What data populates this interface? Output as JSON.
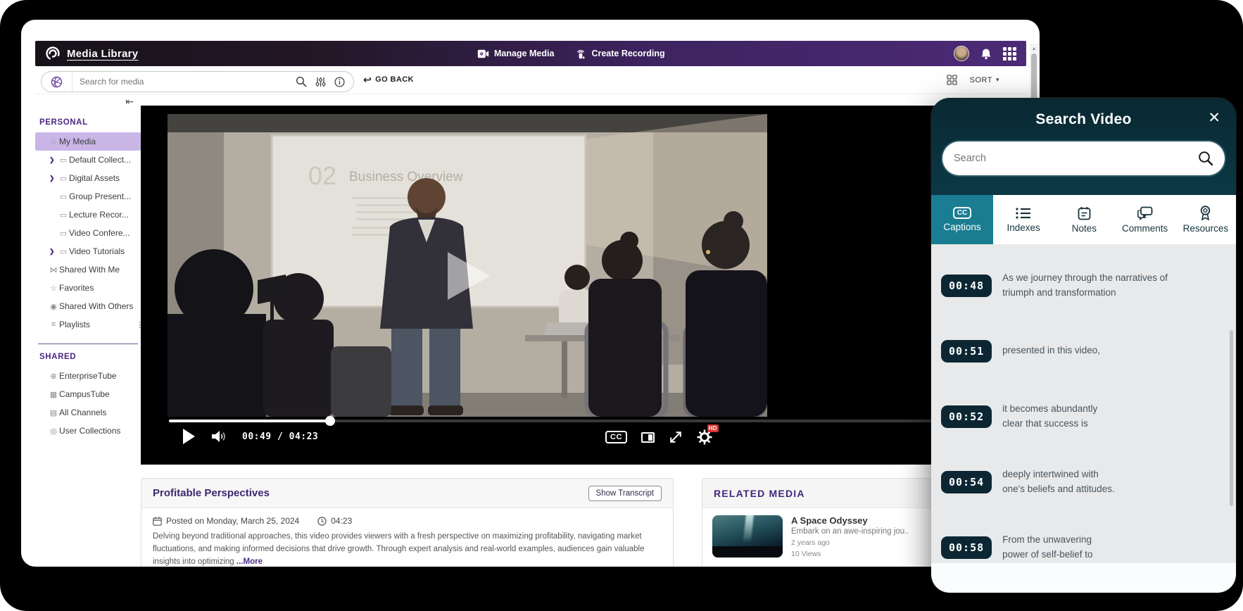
{
  "header": {
    "app_title": "Media Library",
    "manage_media_label": "Manage Media",
    "create_recording_label": "Create Recording"
  },
  "searchbar": {
    "placeholder": "Search for media",
    "go_back_label": "GO BACK",
    "back_arrow_glyph": "↩",
    "sort_label": "SORT",
    "sort_caret_glyph": "▾",
    "scroll_up_glyph": "▴"
  },
  "sidebar": {
    "collapse_glyph": "⇤",
    "chevron_glyph": "❯",
    "personal_label": "PERSONAL",
    "shared_label": "SHARED",
    "personal_items": [
      {
        "label": "My Media",
        "glyph": "⌂",
        "cls": "active",
        "name": "sidebar-item-my-media"
      },
      {
        "label": "Default Collect...",
        "glyph": "▭",
        "cls": "nested chev-on",
        "name": "sidebar-item-default-collections"
      },
      {
        "label": "Digital Assets",
        "glyph": "▭",
        "cls": "nested chev-on",
        "name": "sidebar-item-digital-assets"
      },
      {
        "label": "Group Present...",
        "glyph": "▭",
        "cls": "nested",
        "name": "sidebar-item-group-presentations"
      },
      {
        "label": "Lecture Recor...",
        "glyph": "▭",
        "cls": "nested",
        "name": "sidebar-item-lecture-recordings"
      },
      {
        "label": "Video Confere...",
        "glyph": "▭",
        "cls": "nested",
        "name": "sidebar-item-video-conferences"
      },
      {
        "label": "Video Tutorials",
        "glyph": "▭",
        "cls": "nested chev-on",
        "name": "sidebar-item-video-tutorials"
      },
      {
        "label": "Shared With Me",
        "glyph": "⋈",
        "cls": "",
        "name": "sidebar-item-shared-with-me"
      },
      {
        "label": "Favorites",
        "glyph": "☆",
        "cls": "",
        "name": "sidebar-item-favorites"
      },
      {
        "label": "Shared With Others",
        "glyph": "◉",
        "cls": "",
        "name": "sidebar-item-shared-with-others"
      },
      {
        "label": "Playlists",
        "glyph": "≡",
        "cls": "",
        "name": "sidebar-item-playlists",
        "dots": "⋮"
      }
    ],
    "shared_items": [
      {
        "label": "EnterpriseTube",
        "glyph": "⊕",
        "cls": "",
        "name": "sidebar-item-enterprisetube"
      },
      {
        "label": "CampusTube",
        "glyph": "▦",
        "cls": "",
        "name": "sidebar-item-campustube"
      },
      {
        "label": "All Channels",
        "glyph": "▤",
        "cls": "",
        "name": "sidebar-item-all-channels"
      },
      {
        "label": "User Collections",
        "glyph": "◎",
        "cls": "",
        "name": "sidebar-item-user-collections"
      }
    ]
  },
  "player": {
    "play_glyph": "▶",
    "current_time": "00:49",
    "separator": " / ",
    "duration": "04:23",
    "cc_label": "CC",
    "hd_badge": "HD",
    "progress_percent": 19,
    "slide_number": "02",
    "slide_title": "Business Overview"
  },
  "video_details": {
    "title": "Profitable Perspectives",
    "show_transcript_label": "Show Transcript",
    "posted_text": "Posted on Monday, March 25, 2024",
    "duration": "04:23",
    "description": "Delving beyond traditional approaches, this video provides viewers with a fresh perspective on maximizing profitability, navigating market fluctuations, and making informed decisions that drive growth. Through expert analysis and real-world examples, audiences gain valuable insights into optimizing ",
    "more_label": "...More"
  },
  "related": {
    "heading": "RELATED MEDIA",
    "items": [
      {
        "title": "A Space Odyssey",
        "desc": "Embark on an awe-inspiring jou..",
        "age": "2 years ago",
        "views": "10 Views"
      }
    ]
  },
  "search_panel": {
    "title": "Search Video",
    "close_glyph": "✕",
    "search_placeholder": "Search",
    "tabs": [
      {
        "label": "Captions"
      },
      {
        "label": "Indexes"
      },
      {
        "label": "Notes"
      },
      {
        "label": "Comments"
      },
      {
        "label": "Resources"
      }
    ],
    "captions": [
      {
        "time": "00:48",
        "text": "As we journey through the narratives of\ntriumph and transformation"
      },
      {
        "time": "00:51",
        "text": "presented in this video,"
      },
      {
        "time": "00:52",
        "text": "it becomes abundantly\nclear that success is"
      },
      {
        "time": "00:54",
        "text": "deeply intertwined with\none's beliefs and attitudes."
      },
      {
        "time": "00:58",
        "text": "From the unwavering\npower of self-belief to"
      }
    ]
  },
  "colors": {
    "header_purple": "#4c2b76",
    "accent_purple": "#4c2882",
    "active_item_bg": "#c9b6e7",
    "panel_teal_dark": "#092832",
    "panel_teal": "#0d4553",
    "tab_selected_teal": "#1a7d92",
    "timestamp_bg": "#0c2733",
    "hd_red": "#d63434"
  }
}
